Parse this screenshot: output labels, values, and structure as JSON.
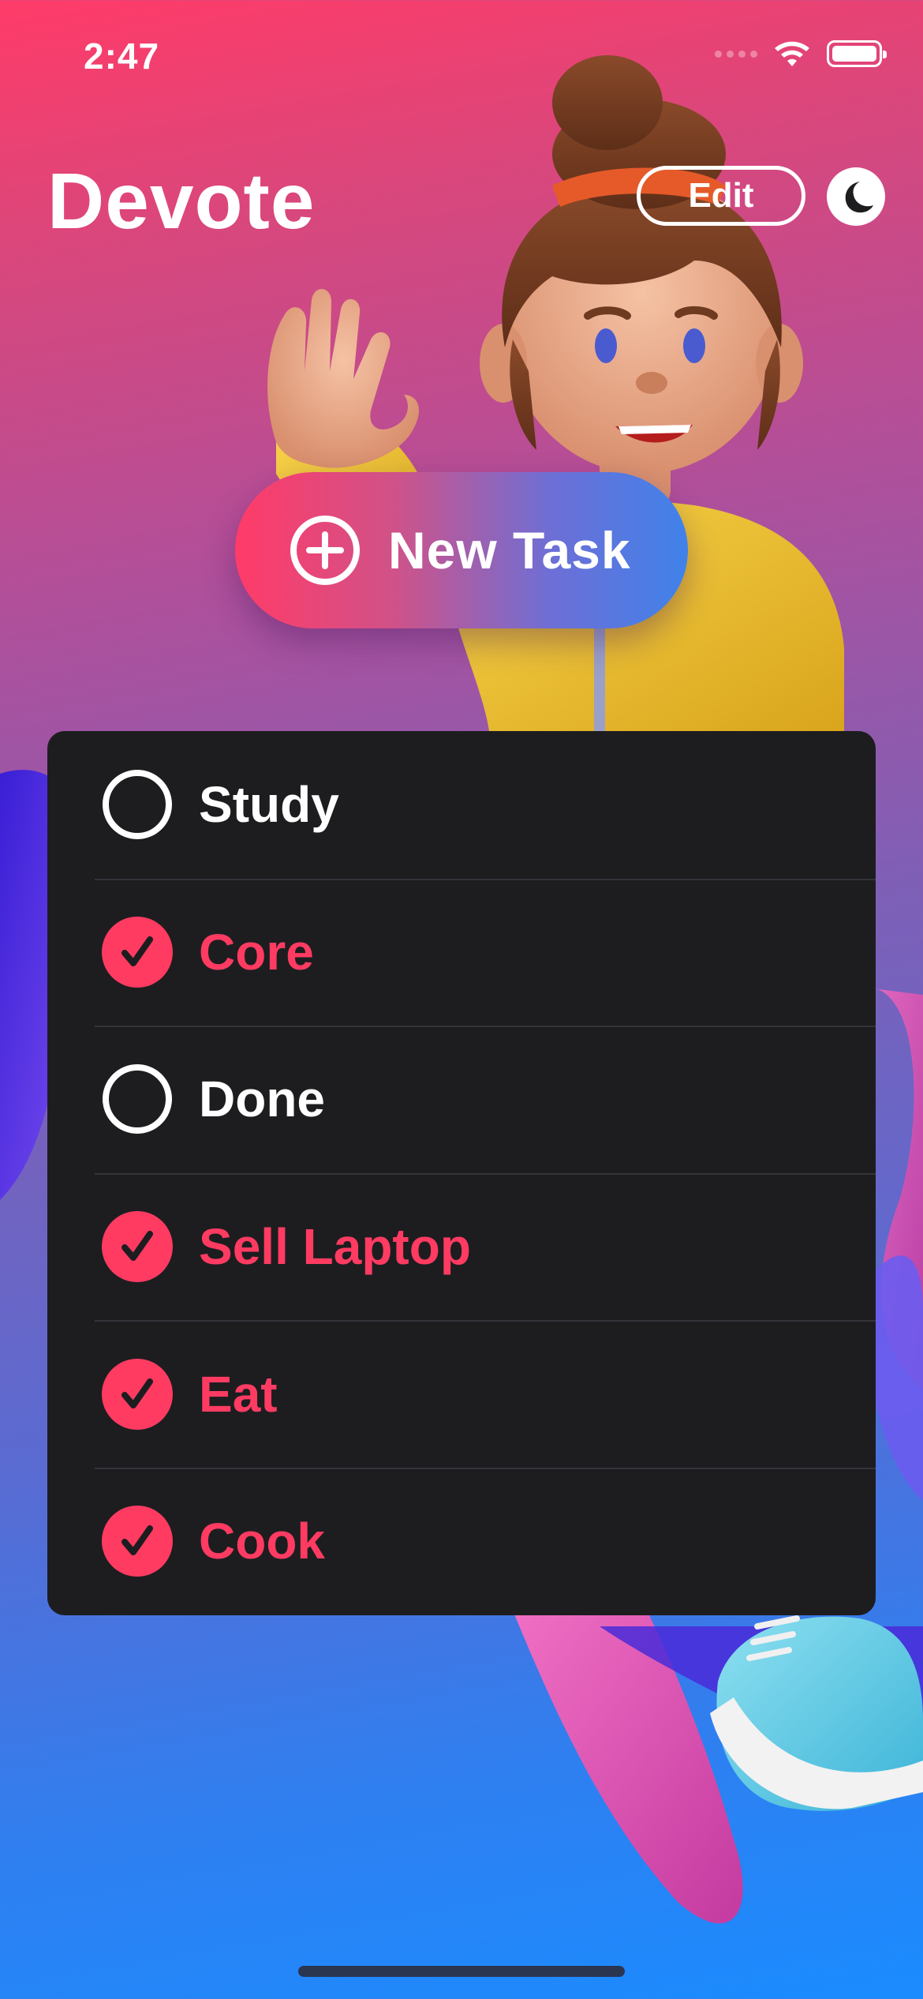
{
  "status_bar": {
    "time": "2:47"
  },
  "header": {
    "title": "Devote",
    "edit_label": "Edit",
    "theme_icon": "moon-icon"
  },
  "new_task": {
    "label": "New Task",
    "icon": "plus-circle-icon"
  },
  "tasks": [
    {
      "label": "Study",
      "completed": false
    },
    {
      "label": "Core",
      "completed": true
    },
    {
      "label": "Done",
      "completed": false
    },
    {
      "label": "Sell Laptop",
      "completed": true
    },
    {
      "label": "Eat",
      "completed": true
    },
    {
      "label": "Cook",
      "completed": true
    }
  ],
  "colors": {
    "accent": "#ff3b62",
    "list_background": "#1d1d20",
    "gradient_top": "#ff3b68",
    "gradient_bottom": "#1a8cff"
  }
}
